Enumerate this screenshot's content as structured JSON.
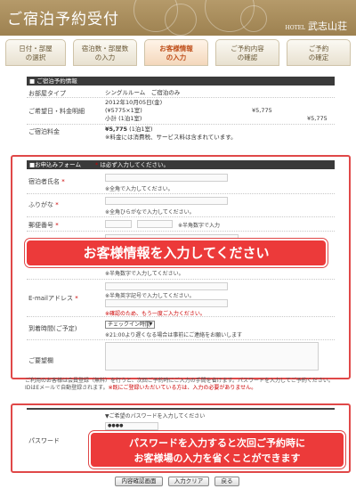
{
  "header": {
    "title": "ご宿泊予約受付",
    "logo_prefix": "HOTEL",
    "logo_name": "武志山荘"
  },
  "tabs": [
    {
      "line1": "日付・部屋",
      "line2": "の選択"
    },
    {
      "line1": "宿泊数・部屋数",
      "line2": "の入力"
    },
    {
      "line1": "お客様情報",
      "line2": "の入力"
    },
    {
      "line1": "ご予約内容",
      "line2": "の確認"
    },
    {
      "line1": "ご予約",
      "line2": "の確定"
    }
  ],
  "booking": {
    "heading": "■ ご宿泊予約情報",
    "room_label": "お部屋タイプ",
    "room_value": "シングルルーム　ご宿泊のみ",
    "date_label": "ご希望日・料金明細",
    "date_line": "2012年10月05日(金)",
    "detail_line": "(¥5775×1室)",
    "detail_amount": "¥5,775",
    "subtotal_line": "小計 (1泊1室)",
    "subtotal_amount": "¥5,775",
    "fee_label": "ご宿泊料金",
    "fee_value": "¥5,775",
    "fee_suffix": "(1泊1室)",
    "fee_note": "※料金には消費税、サービス料は含まれています。"
  },
  "form": {
    "heading": "■お申込みフォーム",
    "required_note": "は必ず入力してください。",
    "required_mark": "*",
    "name_label": "宿泊者氏名",
    "name_hint": "※全角で入力してください。",
    "kana_label": "ふりがな",
    "kana_hint": "※全角ひらがなで入力してください。",
    "zip_label": "郵便番号",
    "zip_hint": "※半角数字で入力",
    "tel_hint": "※半角数字で入力してください。",
    "email_label": "E-mailアドレス",
    "email_hint": "※半角英字記号で入力してください。",
    "confirm_hint": "※確認のため、もう一度ご入力ください。",
    "arrival_label": "到着時間(ご予定)",
    "arrival_value": "チェックイン時間",
    "arrival_hint": "※21:00より遅くなる場合は事前にご連絡をお願いします",
    "request_label": "ご要望欄"
  },
  "notice": {
    "text": "ご利用のお客様は会員登録（無料）を行うと、次回ご予約時にご入力の手間を省けます。パスワードを入力してご予約ください。IDはEメールで自動登録されます。",
    "red_text": "※既にご登録いただいている方は、入力の必要がありません。"
  },
  "password": {
    "hint": "▼ご希望のパスワードを入力してください",
    "label": "パスワード",
    "dots": "●●●●"
  },
  "banners": {
    "main": "お客様情報を入力してください",
    "password_line1": "パスワードを入力すると次回ご予約時に",
    "password_line2": "お客様場の入力を省くことができます"
  },
  "buttons": {
    "confirm": "内容確認画面",
    "clear": "入力クリア",
    "back": "戻る"
  },
  "colors": {
    "header": "#a88d5c",
    "active_tab": "#c0501c",
    "highlight": "#e04848"
  }
}
